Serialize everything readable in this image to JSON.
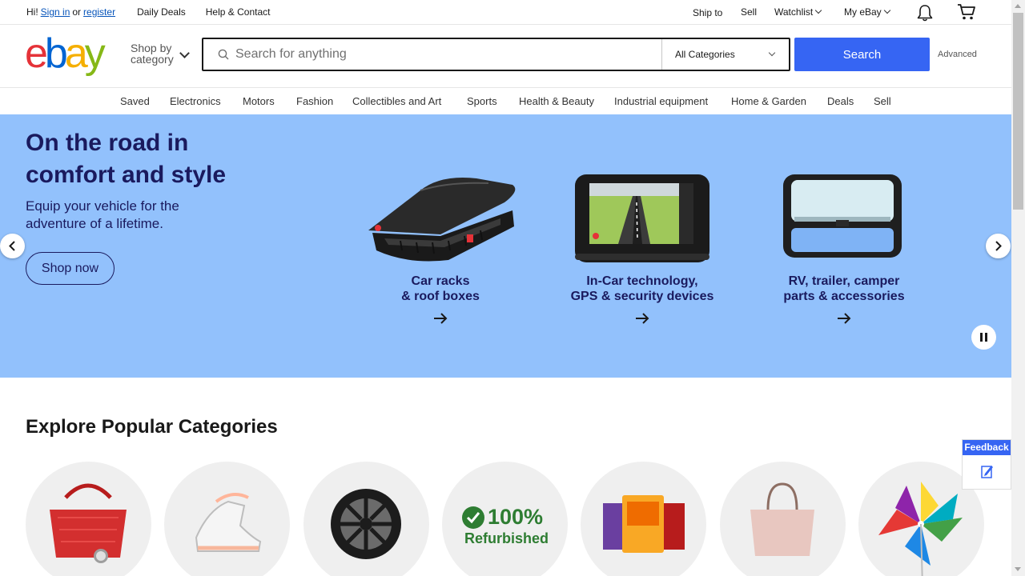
{
  "topbar": {
    "greeting": "Hi!",
    "sign_in": "Sign in",
    "or": "or",
    "register": "register",
    "daily_deals": "Daily Deals",
    "help_contact": "Help & Contact",
    "ship_to": "Ship to",
    "sell": "Sell",
    "watchlist": "Watchlist",
    "my_ebay": "My eBay"
  },
  "header": {
    "logo": [
      "e",
      "b",
      "a",
      "y"
    ],
    "shop_by_line1": "Shop by",
    "shop_by_line2": "category",
    "search_placeholder": "Search for anything",
    "category_selected": "All Categories",
    "search_button": "Search",
    "advanced": "Advanced"
  },
  "nav": {
    "items": [
      "Saved",
      "Electronics",
      "Motors",
      "Fashion",
      "Collectibles and Art",
      "Sports",
      "Health & Beauty",
      "Industrial equipment",
      "Home & Garden",
      "Deals",
      "Sell"
    ]
  },
  "hero": {
    "title": "On the road in comfort and style",
    "subtitle": "Equip your vehicle for the adventure of a lifetime.",
    "cta": "Shop now",
    "tiles": [
      {
        "line1": "Car racks",
        "line2": "& roof boxes"
      },
      {
        "line1": "In-Car technology,",
        "line2": "GPS & security devices"
      },
      {
        "line1": "RV, trailer, camper",
        "line2": "parts & accessories"
      }
    ],
    "background_color": "#92c1fc",
    "text_color": "#1a1a5e"
  },
  "explore": {
    "title": "Explore Popular Categories",
    "refurbished_pct": "100%",
    "refurbished_label": "Refurbished"
  },
  "feedback": {
    "label": "Feedback"
  },
  "colors": {
    "accent_blue": "#3665f3",
    "logo_red": "#e53238",
    "logo_blue": "#0064d2",
    "logo_yellow": "#f5af02",
    "logo_green": "#86b817"
  }
}
